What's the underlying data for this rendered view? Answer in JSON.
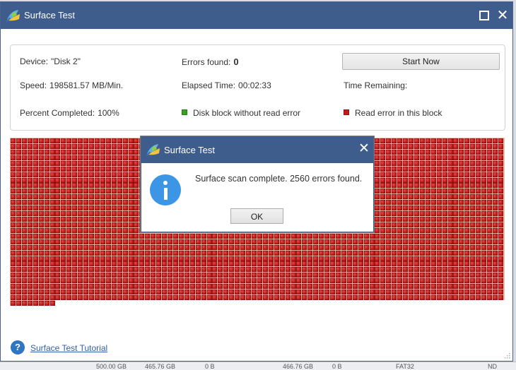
{
  "window": {
    "title": "Surface Test",
    "icon": "surface-test-app-icon",
    "controls": {
      "maximize": "maximize-icon",
      "close": "close-icon"
    }
  },
  "info": {
    "device_label": "Device:",
    "device_value": "\"Disk 2\"",
    "errors_label": "Errors found:",
    "errors_value": "0",
    "start_button": "Start Now",
    "speed_label": "Speed:",
    "speed_value": "198581.57 MB/Min.",
    "elapsed_label": "Elapsed Time:",
    "elapsed_value": "00:02:33",
    "remaining_label": "Time Remaining:",
    "remaining_value": "",
    "percent_label": "Percent Completed:",
    "percent_value": "100%"
  },
  "legend": {
    "ok_label": "Disk block without read error",
    "ok_color": "#3aa022",
    "error_label": "Read error in this block",
    "error_color": "#c21a1a"
  },
  "block_map": {
    "columns": 88,
    "total_blocks": 2560,
    "error_blocks": 2560,
    "ok_blocks": 0
  },
  "dialog": {
    "title": "Surface Test",
    "icon": "info-icon",
    "message": "Surface scan complete. 2560 errors found.",
    "ok_button": "OK"
  },
  "footer": {
    "help_icon": "question-icon",
    "help_glyph": "?",
    "tutorial_link": "Surface Test Tutorial"
  },
  "background_strip": {
    "texts": [
      "500.00 GB",
      "465.76 GB",
      "0 B",
      "466.76 GB",
      "0 B",
      "FAT32",
      "ND"
    ]
  }
}
